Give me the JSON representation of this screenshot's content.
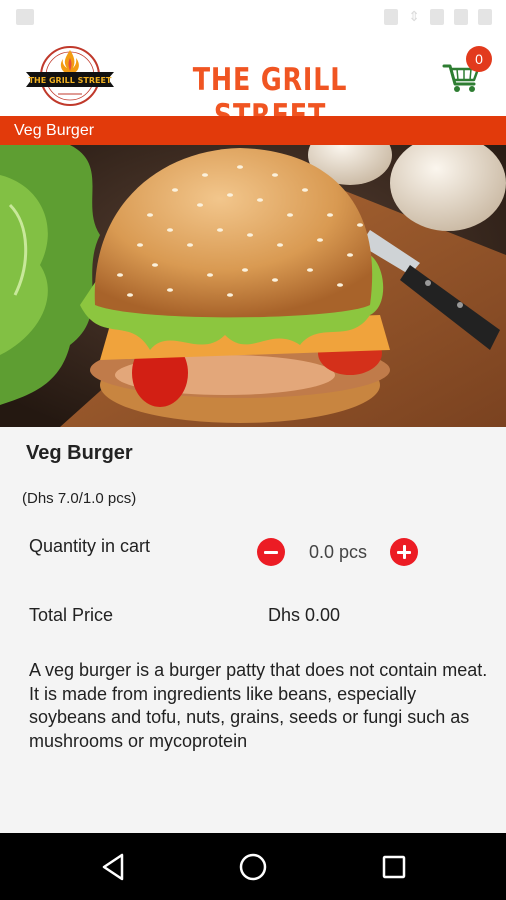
{
  "app": {
    "title": "THE GRILL STREET",
    "logo_text": "THE GRILL STREET"
  },
  "cart": {
    "count": "0"
  },
  "category": {
    "title": "Veg Burger"
  },
  "product": {
    "name": "Veg Burger",
    "unit_price": "(Dhs 7.0/1.0 pcs)",
    "quantity_label": "Quantity in cart",
    "quantity_value": "0.0 pcs",
    "total_label": "Total Price",
    "total_value": "Dhs 0.00",
    "description": "A veg burger is a burger patty that does not contain meat. It is made from ingredients like beans, especially soybeans and tofu, nuts, grains, seeds or fungi such as mushrooms or mycoprotein"
  },
  "icons": {
    "cart": "shopping-cart-icon",
    "minus": "minus-circle-icon",
    "plus": "plus-circle-icon",
    "back": "back-triangle-icon",
    "home": "home-circle-icon",
    "recents": "recents-square-icon"
  },
  "colors": {
    "brand": "#f05522",
    "category_bar": "#e23a0b",
    "buttons": "#ec1c24",
    "cart_icon": "#2e7d32"
  }
}
